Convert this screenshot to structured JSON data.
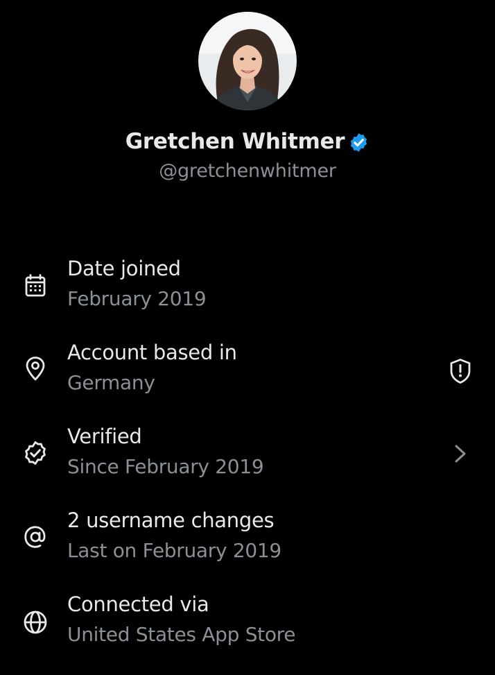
{
  "profile": {
    "display_name": "Gretchen Whitmer",
    "handle": "@gretchenwhitmer",
    "verified": true,
    "avatar_alt": "Profile photo"
  },
  "colors": {
    "background": "#000000",
    "primary_text": "#e7e9ea",
    "secondary_text": "#8b9097",
    "verified_blue": "#1d9bf0"
  },
  "about": [
    {
      "icon": "calendar-icon",
      "title": "Date joined",
      "subtitle": "February 2019",
      "trailing": null
    },
    {
      "icon": "location-pin-icon",
      "title": "Account based in",
      "subtitle": "Germany",
      "trailing": "shield-alert-icon"
    },
    {
      "icon": "verified-badge-icon",
      "title": "Verified",
      "subtitle": "Since February 2019",
      "trailing": "chevron-right-icon"
    },
    {
      "icon": "at-sign-icon",
      "title": "2 username changes",
      "subtitle": "Last on February 2019",
      "trailing": null
    },
    {
      "icon": "globe-icon",
      "title": "Connected via",
      "subtitle": "United States App Store",
      "trailing": null
    }
  ]
}
